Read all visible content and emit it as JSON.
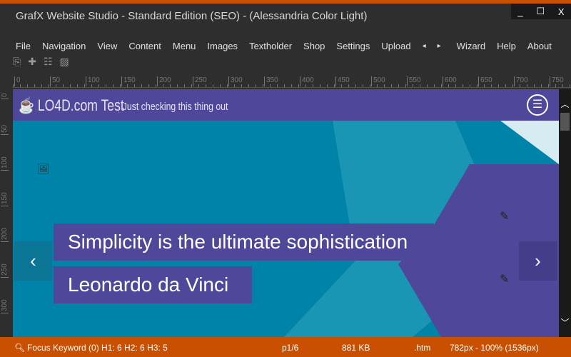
{
  "window": {
    "title": "GrafX Website Studio - Standard Edition (SEO) - (Alessandria Color Light)",
    "controls": [
      "_",
      "☐",
      "X"
    ]
  },
  "menu": [
    "File",
    "Navigation",
    "View",
    "Content",
    "Menu",
    "Images",
    "Textholder",
    "Shop",
    "Settings",
    "Upload",
    "◂",
    "▸",
    "Wizard",
    "Help",
    "About"
  ],
  "toolbar_icons": [
    "copy-icon",
    "puzzle-icon",
    "text-layout-icon",
    "image-icon"
  ],
  "ruler": {
    "h": [
      "0",
      "50",
      "100",
      "150",
      "200",
      "250",
      "300",
      "350",
      "400",
      "450",
      "500",
      "550",
      "600",
      "650",
      "700",
      "750"
    ],
    "v": [
      "0",
      "50",
      "100",
      "150",
      "200",
      "250",
      "300"
    ]
  },
  "site": {
    "logo": "LO4D.com Test",
    "tagline": "Just checking this thing out",
    "caption1": "Simplicity is the ultimate sophistication",
    "caption2": "Leonardo da Vinci"
  },
  "status": {
    "seo": "Focus Keyword (0) H1: 6 H2: 6 H3: 5",
    "page": "p1/6",
    "size": "881 KB",
    "ext": ".htm",
    "zoom": "782px - 100% (1536px)"
  },
  "colors": {
    "accent": "#c85000",
    "purple": "#4f479a",
    "teal": "#0083a8"
  }
}
